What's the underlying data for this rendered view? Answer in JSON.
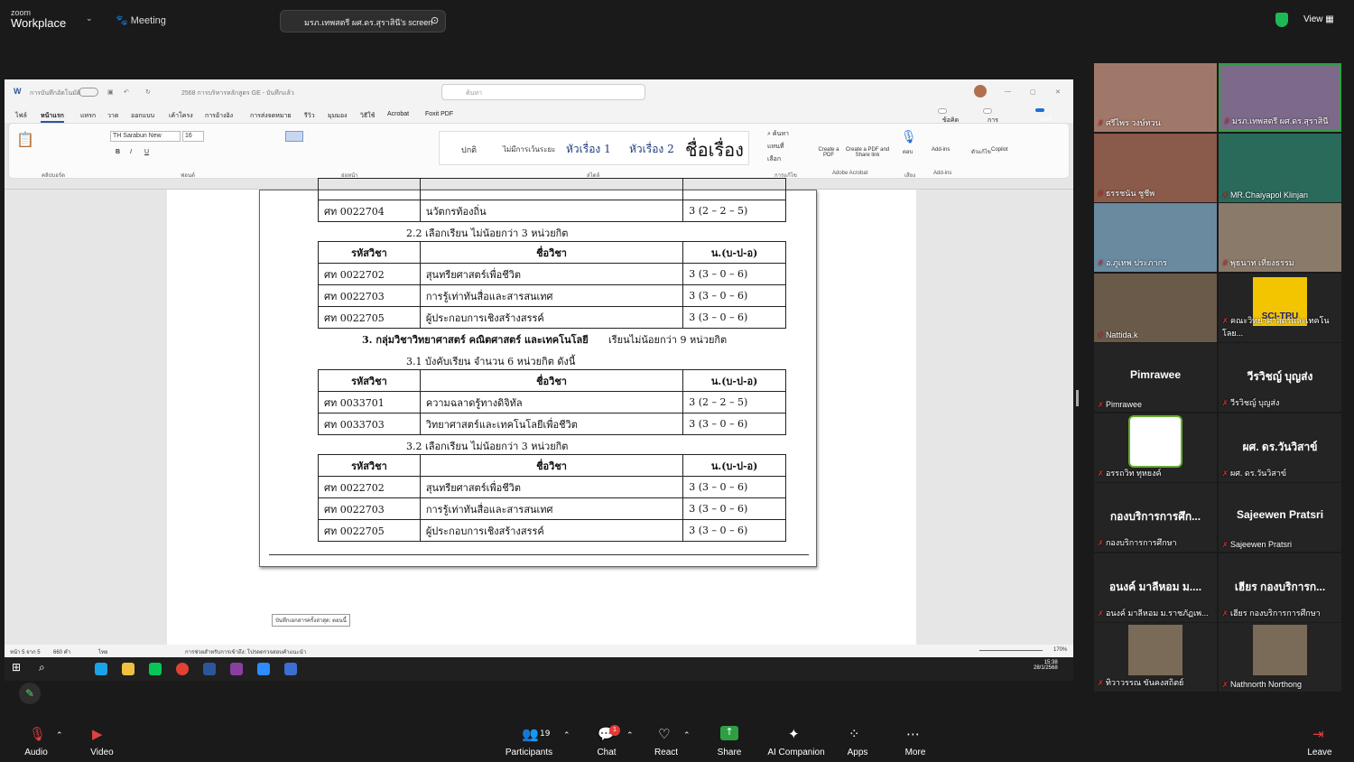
{
  "zoom": {
    "logo_small": "zoom",
    "logo_big": "Workplace",
    "meeting_label": "Meeting",
    "screen_share_label": "มรภ.เทพสตรี ผศ.ดร.สุราสินี's screen",
    "view_label": "View"
  },
  "word": {
    "autosave_label": "การบันทึกอัตโนมัติ",
    "doc_title": "2568 การบริหารหลักสูตร GE - บันทึกแล้ว",
    "search_placeholder": "ค้นหา",
    "menu": [
      "ไฟล์",
      "หน้าแรก",
      "แทรก",
      "วาด",
      "ออกแบบ",
      "เค้าโครง",
      "การอ้างอิง",
      "การส่งจดหมาย",
      "รีวิว",
      "มุมมอง",
      "วิธีใช้",
      "Acrobat",
      "Foxit PDF"
    ],
    "comments_btn": "ข้อคิดเห็น",
    "editing_btn": "การแก้ไข",
    "share_btn": "แชร์",
    "font_name": "TH Sarabun New",
    "font_size": "16",
    "styles": [
      "ปกติ",
      "ไม่มีการเว้นระยะ",
      "หัวเรื่อง 1",
      "หัวเรื่อง 2",
      "ชื่อเรื่อง"
    ],
    "group_labels": [
      "คลิปบอร์ด",
      "ฟอนต์",
      "ย่อหน้า",
      "สไตล์",
      "การแก้ไข",
      "Adobe Acrobat",
      "เสียง",
      "Add-ins"
    ],
    "ribbon_buttons": [
      "ค้นหา",
      "แทนที่",
      "เลือก",
      "Create a PDF",
      "Create a PDF and Share link",
      "ตอบ",
      "Add-ins",
      "ตัวแก้ไข",
      "Copilot"
    ]
  },
  "document": {
    "top_row": {
      "code": "ศท 0022704",
      "name": "นวัตกรท้องถิ่น",
      "credit": "3 (2 – 2 – 5)"
    },
    "heading_22": "2.2 เลือกเรียน   ไม่น้อยกว่า     3     หน่วยกิต",
    "headers": [
      "รหัสวิชา",
      "ชื่อวิชา",
      "น.(บ-ป-อ)"
    ],
    "table_22": [
      {
        "code": "ศท 0022702",
        "name": "สุนทรียศาสตร์เพื่อชีวิต",
        "credit": "3 (3 – 0 – 6)"
      },
      {
        "code": "ศท 0022703",
        "name": "การรู้เท่าทันสื่อและสารสนเทศ",
        "credit": "3 (3 – 0 – 6)"
      },
      {
        "code": "ศท 0022705",
        "name": "ผู้ประกอบการเชิงสร้างสรรค์",
        "credit": "3 (3 – 0 – 6)"
      }
    ],
    "heading_3": "3. กลุ่มวิชาวิทยาศาสตร์ คณิตศาสตร์ และเทคโนโลยี",
    "heading_3b": "เรียนไม่น้อยกว่า     9      หน่วยกิต",
    "heading_31": "3.1 บังคับเรียน      จำนวน     6    หน่วยกิต   ดังนี้",
    "table_31": [
      {
        "code": "ศท 0033701",
        "name": "ความฉลาดรู้ทางดิจิทัล",
        "credit": "3 (2 – 2 – 5)"
      },
      {
        "code": "ศท 0033703",
        "name": "วิทยาศาสตร์และเทคโนโลยีเพื่อชีวิต",
        "credit": "3 (3 – 0 – 6)"
      }
    ],
    "heading_32": "3.2 เลือกเรียน   ไม่น้อยกว่า    3    หน่วยกิต",
    "table_32": [
      {
        "code": "ศท 0022702",
        "name": "สุนทรียศาสตร์เพื่อชีวิต",
        "credit": "3 (3 – 0 – 6)"
      },
      {
        "code": "ศท 0022703",
        "name": "การรู้เท่าทันสื่อและสารสนเทศ",
        "credit": "3 (3 – 0 – 6)"
      },
      {
        "code": "ศท 0022705",
        "name": "ผู้ประกอบการเชิงสร้างสรรค์",
        "credit": "3 (3 – 0 – 6)"
      }
    ]
  },
  "statusbar": {
    "page": "หน้า 5 จาก 5",
    "words": "660 คำ",
    "lang": "ไทย",
    "accessibility": "การช่วยสำหรับการเข้าถึง: โปรดตรวจสอบคำแนะนำ",
    "zoom": "170%",
    "tooltip": "บันทึกเอกสารครั้งล่าสุด: ตอนนี้"
  },
  "taskbar": {
    "time": "15:38",
    "date": "28/1/2568"
  },
  "participants": [
    {
      "name": "ศรีไพร วงษ์ทวน",
      "type": "video"
    },
    {
      "name": "มรภ.เทพสตรี ผศ.ดร.สุราสินี",
      "type": "video"
    },
    {
      "name": "ธรรชนัน ชูชีพ",
      "type": "video"
    },
    {
      "name": "MR.Chaiyapol Klinjan",
      "type": "video"
    },
    {
      "name": "อ.ภูเทพ ประภากร",
      "type": "video"
    },
    {
      "name": "พุธนาท เที่ยงธรรม",
      "type": "video"
    },
    {
      "name": "Nattida.k",
      "type": "video"
    },
    {
      "name": "คณะวิทยาศาสตร์และเทคโนโลย...",
      "type": "logo",
      "logo_text": "SCI-TRU"
    },
    {
      "name": "Pimrawee",
      "type": "name",
      "big": "Pimrawee"
    },
    {
      "name": "วีรวิชญ์ บุญส่ง",
      "type": "name",
      "big": "วีรวิชญ์ บุญส่ง"
    },
    {
      "name": "อรรถวิท ทุหยงค์",
      "type": "logo2"
    },
    {
      "name": "ผศ. ดร.วันวิสาข์",
      "type": "name",
      "big": "ผศ. ดร.วันวิสาข์"
    },
    {
      "name": "กองบริการการศึกษา",
      "type": "name",
      "big": "กองบริการการศึก..."
    },
    {
      "name": "Sajeewen Pratsri",
      "type": "name",
      "big": "Sajeewen Pratsri"
    },
    {
      "name": "อนงค์ มาลีหอม ม.ราชภัฏเพ...",
      "type": "name",
      "big": "อนงค์ มาลีหอม ม...."
    },
    {
      "name": "เฮียร กองบริการการศึกษา",
      "type": "name",
      "big": "เฮียร กองบริการก..."
    },
    {
      "name": "ทิวาวรรณ ขันคงสถิตย์",
      "type": "photo"
    },
    {
      "name": "Nathnorth Northong",
      "type": "photo"
    }
  ],
  "controls": {
    "audio": "Audio",
    "video": "Video",
    "participants": "Participants",
    "participants_count": "19",
    "chat": "Chat",
    "chat_badge": "1",
    "react": "React",
    "share": "Share",
    "ai": "AI Companion",
    "apps": "Apps",
    "more": "More",
    "leave": "Leave"
  }
}
